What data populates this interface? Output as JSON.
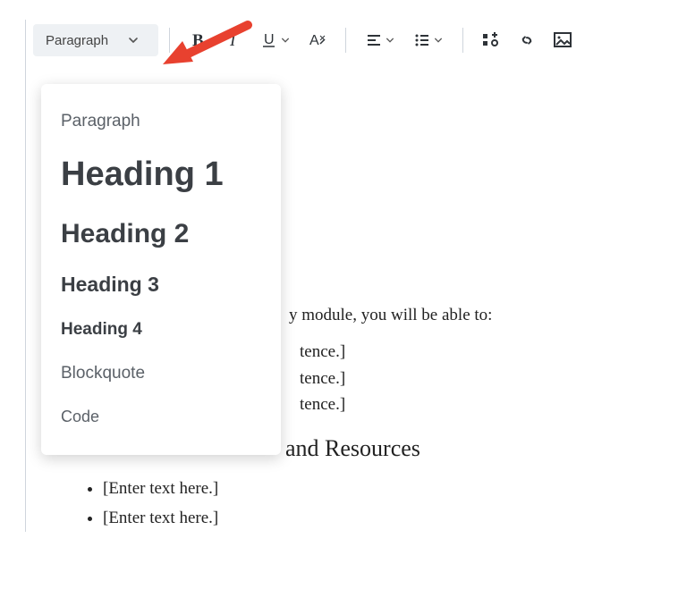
{
  "toolbar": {
    "format_select_label": "Paragraph"
  },
  "dropdown": {
    "items": [
      {
        "label": "Paragraph",
        "class": "paragraph"
      },
      {
        "label": "Heading 1",
        "class": "h1"
      },
      {
        "label": "Heading 2",
        "class": "h2"
      },
      {
        "label": "Heading 3",
        "class": "h3"
      },
      {
        "label": "Heading 4",
        "class": "h4"
      },
      {
        "label": "Blockquote",
        "class": "bq"
      },
      {
        "label": "Code",
        "class": "code"
      }
    ]
  },
  "content": {
    "intro_tail": "y module, you will be able to:",
    "obj_tail_1": "tence.]",
    "obj_tail_2": "tence.]",
    "obj_tail_3": "tence.]",
    "section_heading_tail": " and Resources",
    "bullets": [
      "[Enter text here.]",
      "[Enter text here.]"
    ]
  },
  "colors": {
    "arrow": "#e8412f"
  }
}
